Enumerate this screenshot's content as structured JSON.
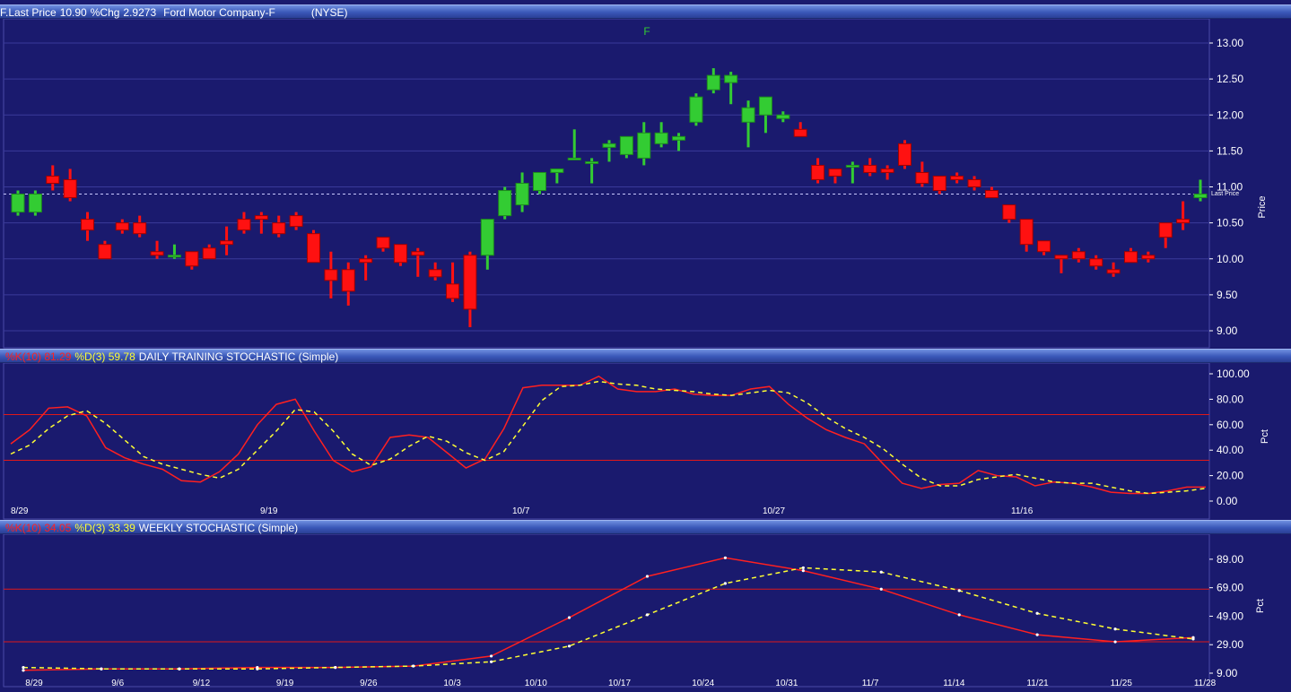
{
  "header": {
    "symbol_label": "F.Last Price",
    "last_price": "10.90",
    "pctchg_label": "%Chg",
    "pctchg": "2.9273",
    "company": "Ford Motor Company-F",
    "exchange": "(NYSE)"
  },
  "colors": {
    "background": "#1a1a6e",
    "up": "#33cc33",
    "down": "#ff1111",
    "k_line": "#ff2020",
    "d_line": "#ffff33",
    "grid": "#3a3a9a",
    "axis_text": "#ffffff"
  },
  "chart_data": [
    {
      "type": "candlestick",
      "title": "F",
      "ylabel": "Price",
      "ylim": [
        9.0,
        13.0
      ],
      "yticks": [
        "13.00",
        "12.50",
        "12.00",
        "11.50",
        "11.00",
        "10.50",
        "10.00",
        "9.50",
        "9.00"
      ],
      "last_price": 10.9,
      "last_price_label": "Last Price",
      "grid": true,
      "candles": [
        {
          "o": 10.65,
          "h": 10.95,
          "l": 10.6,
          "c": 10.9
        },
        {
          "o": 10.65,
          "h": 10.95,
          "l": 10.6,
          "c": 10.9
        },
        {
          "o": 11.15,
          "h": 11.3,
          "l": 10.95,
          "c": 11.05
        },
        {
          "o": 11.1,
          "h": 11.25,
          "l": 10.8,
          "c": 10.85
        },
        {
          "o": 10.55,
          "h": 10.65,
          "l": 10.25,
          "c": 10.4
        },
        {
          "o": 10.2,
          "h": 10.25,
          "l": 10.0,
          "c": 10.0
        },
        {
          "o": 10.5,
          "h": 10.55,
          "l": 10.35,
          "c": 10.4
        },
        {
          "o": 10.5,
          "h": 10.6,
          "l": 10.3,
          "c": 10.35
        },
        {
          "o": 10.1,
          "h": 10.25,
          "l": 10.0,
          "c": 10.05
        },
        {
          "o": 10.05,
          "h": 10.2,
          "l": 10.0,
          "c": 10.05
        },
        {
          "o": 10.1,
          "h": 10.1,
          "l": 9.85,
          "c": 9.9
        },
        {
          "o": 10.15,
          "h": 10.2,
          "l": 10.0,
          "c": 10.0
        },
        {
          "o": 10.25,
          "h": 10.45,
          "l": 10.05,
          "c": 10.2
        },
        {
          "o": 10.55,
          "h": 10.65,
          "l": 10.35,
          "c": 10.4
        },
        {
          "o": 10.6,
          "h": 10.65,
          "l": 10.35,
          "c": 10.55
        },
        {
          "o": 10.5,
          "h": 10.6,
          "l": 10.3,
          "c": 10.35
        },
        {
          "o": 10.6,
          "h": 10.65,
          "l": 10.4,
          "c": 10.45
        },
        {
          "o": 10.35,
          "h": 10.4,
          "l": 9.95,
          "c": 9.95
        },
        {
          "o": 9.85,
          "h": 10.1,
          "l": 9.45,
          "c": 9.7
        },
        {
          "o": 9.85,
          "h": 9.95,
          "l": 9.35,
          "c": 9.55
        },
        {
          "o": 10.0,
          "h": 10.05,
          "l": 9.7,
          "c": 9.95
        },
        {
          "o": 10.3,
          "h": 10.3,
          "l": 10.1,
          "c": 10.15
        },
        {
          "o": 10.2,
          "h": 10.2,
          "l": 9.9,
          "c": 9.95
        },
        {
          "o": 10.1,
          "h": 10.15,
          "l": 9.75,
          "c": 10.05
        },
        {
          "o": 9.85,
          "h": 9.95,
          "l": 9.7,
          "c": 9.75
        },
        {
          "o": 9.65,
          "h": 9.95,
          "l": 9.4,
          "c": 9.45
        },
        {
          "o": 10.05,
          "h": 10.1,
          "l": 9.05,
          "c": 9.3
        },
        {
          "o": 10.05,
          "h": 10.55,
          "l": 9.85,
          "c": 10.55
        },
        {
          "o": 10.6,
          "h": 11.0,
          "l": 10.55,
          "c": 10.95
        },
        {
          "o": 10.75,
          "h": 11.2,
          "l": 10.65,
          "c": 11.05
        },
        {
          "o": 10.95,
          "h": 11.2,
          "l": 10.9,
          "c": 11.2
        },
        {
          "o": 11.2,
          "h": 11.25,
          "l": 11.05,
          "c": 11.25
        },
        {
          "o": 11.4,
          "h": 11.8,
          "l": 11.4,
          "c": 11.4
        },
        {
          "o": 11.35,
          "h": 11.4,
          "l": 11.05,
          "c": 11.35
        },
        {
          "o": 11.55,
          "h": 11.65,
          "l": 11.35,
          "c": 11.6
        },
        {
          "o": 11.45,
          "h": 11.7,
          "l": 11.4,
          "c": 11.7
        },
        {
          "o": 11.4,
          "h": 11.9,
          "l": 11.3,
          "c": 11.75
        },
        {
          "o": 11.6,
          "h": 11.9,
          "l": 11.55,
          "c": 11.75
        },
        {
          "o": 11.65,
          "h": 11.75,
          "l": 11.5,
          "c": 11.7
        },
        {
          "o": 11.9,
          "h": 12.3,
          "l": 11.85,
          "c": 12.25
        },
        {
          "o": 12.35,
          "h": 12.65,
          "l": 12.3,
          "c": 12.55
        },
        {
          "o": 12.45,
          "h": 12.6,
          "l": 12.15,
          "c": 12.55
        },
        {
          "o": 11.9,
          "h": 12.2,
          "l": 11.55,
          "c": 12.1
        },
        {
          "o": 12.0,
          "h": 12.25,
          "l": 11.75,
          "c": 12.25
        },
        {
          "o": 11.95,
          "h": 12.05,
          "l": 11.9,
          "c": 12.0
        },
        {
          "o": 11.8,
          "h": 11.9,
          "l": 11.7,
          "c": 11.7
        },
        {
          "o": 11.3,
          "h": 11.4,
          "l": 11.05,
          "c": 11.1
        },
        {
          "o": 11.25,
          "h": 11.25,
          "l": 11.05,
          "c": 11.15
        },
        {
          "o": 11.3,
          "h": 11.35,
          "l": 11.05,
          "c": 11.3
        },
        {
          "o": 11.3,
          "h": 11.4,
          "l": 11.15,
          "c": 11.2
        },
        {
          "o": 11.25,
          "h": 11.3,
          "l": 11.1,
          "c": 11.2
        },
        {
          "o": 11.6,
          "h": 11.65,
          "l": 11.25,
          "c": 11.3
        },
        {
          "o": 11.2,
          "h": 11.35,
          "l": 11.0,
          "c": 11.05
        },
        {
          "o": 11.15,
          "h": 11.15,
          "l": 10.9,
          "c": 10.95
        },
        {
          "o": 11.15,
          "h": 11.2,
          "l": 11.05,
          "c": 11.1
        },
        {
          "o": 11.1,
          "h": 11.15,
          "l": 10.95,
          "c": 11.0
        },
        {
          "o": 10.95,
          "h": 11.0,
          "l": 10.85,
          "c": 10.85
        },
        {
          "o": 10.75,
          "h": 10.75,
          "l": 10.5,
          "c": 10.55
        },
        {
          "o": 10.55,
          "h": 10.55,
          "l": 10.1,
          "c": 10.2
        },
        {
          "o": 10.25,
          "h": 10.25,
          "l": 10.05,
          "c": 10.1
        },
        {
          "o": 10.05,
          "h": 10.05,
          "l": 9.8,
          "c": 10.0
        },
        {
          "o": 10.1,
          "h": 10.15,
          "l": 9.95,
          "c": 10.0
        },
        {
          "o": 10.0,
          "h": 10.05,
          "l": 9.85,
          "c": 9.9
        },
        {
          "o": 9.85,
          "h": 9.95,
          "l": 9.75,
          "c": 9.8
        },
        {
          "o": 10.1,
          "h": 10.15,
          "l": 9.95,
          "c": 9.95
        },
        {
          "o": 10.05,
          "h": 10.1,
          "l": 9.95,
          "c": 10.0
        },
        {
          "o": 10.5,
          "h": 10.5,
          "l": 10.15,
          "c": 10.3
        },
        {
          "o": 10.55,
          "h": 10.8,
          "l": 10.4,
          "c": 10.5
        },
        {
          "o": 10.85,
          "h": 11.1,
          "l": 10.8,
          "c": 10.9
        }
      ]
    },
    {
      "type": "line",
      "title_k": "%K(10) 81.29",
      "title_d": "%D(3) 59.78",
      "title": "DAILY TRAINING STOCHASTIC (Simple)",
      "ylabel": "Pct",
      "ylim": [
        0,
        100
      ],
      "yticks": [
        "100.00",
        "80.00",
        "60.00",
        "40.00",
        "20.00",
        "0.00"
      ],
      "ref_lines": [
        68,
        32
      ],
      "x_labels": [
        {
          "label": "8/29",
          "i": 0
        },
        {
          "label": "9/19",
          "i": 14
        },
        {
          "label": "10/7",
          "i": 27
        },
        {
          "label": "10/27",
          "i": 40
        },
        {
          "label": "11/16",
          "i": 53
        }
      ],
      "n_points": 64,
      "series": [
        {
          "name": "%K(10)",
          "values": [
            45,
            56,
            73,
            74,
            67,
            42,
            34,
            29,
            25,
            16,
            15,
            23,
            37,
            60,
            76,
            80,
            55,
            32,
            23,
            27,
            50,
            52,
            50,
            38,
            26,
            33,
            57,
            89,
            91,
            91,
            91,
            98,
            88,
            86,
            86,
            88,
            84,
            83,
            83,
            88,
            90,
            76,
            65,
            56,
            50,
            45,
            29,
            14,
            10,
            13,
            14,
            24,
            20,
            19,
            12,
            15,
            14,
            11,
            7,
            6,
            6,
            8,
            11,
            11
          ]
        },
        {
          "name": "%D(3)",
          "values": [
            37,
            44,
            57,
            67,
            71,
            61,
            48,
            35,
            29,
            25,
            21,
            18,
            25,
            40,
            55,
            72,
            70,
            55,
            37,
            28,
            33,
            43,
            51,
            47,
            38,
            32,
            39,
            59,
            79,
            90,
            91,
            94,
            92,
            91,
            88,
            87,
            86,
            84,
            83,
            85,
            87,
            85,
            77,
            66,
            57,
            50,
            41,
            29,
            18,
            12,
            12,
            17,
            19,
            21,
            18,
            15,
            14,
            14,
            11,
            8,
            6,
            7,
            8,
            10
          ]
        }
      ]
    },
    {
      "type": "line",
      "title_k": "%K(10) 34.05",
      "title_d": "%D(3) 33.39",
      "title": "WEEKLY STOCHASTIC (Simple)",
      "ylabel": "Pct",
      "ylim": [
        9,
        99
      ],
      "yticks": [
        "89.00",
        "69.00",
        "49.00",
        "29.00",
        "9.00"
      ],
      "ref_lines": [
        68,
        31
      ],
      "x_labels": [
        "8/29",
        "9/6",
        "9/12",
        "9/19",
        "9/26",
        "10/3",
        "10/10",
        "10/17",
        "10/24",
        "10/31",
        "11/7",
        "11/14",
        "11/21",
        "11/25",
        "11/28"
      ],
      "series": [
        {
          "name": "%K(10)",
          "values": [
            11,
            12,
            12,
            13,
            13,
            14,
            21,
            48,
            77,
            90,
            81,
            68,
            50,
            36,
            31,
            34
          ]
        },
        {
          "name": "%D(3)",
          "values": [
            13,
            12,
            12,
            12,
            13,
            14,
            17,
            28,
            50,
            72,
            83,
            80,
            67,
            51,
            40,
            33
          ]
        }
      ]
    }
  ]
}
